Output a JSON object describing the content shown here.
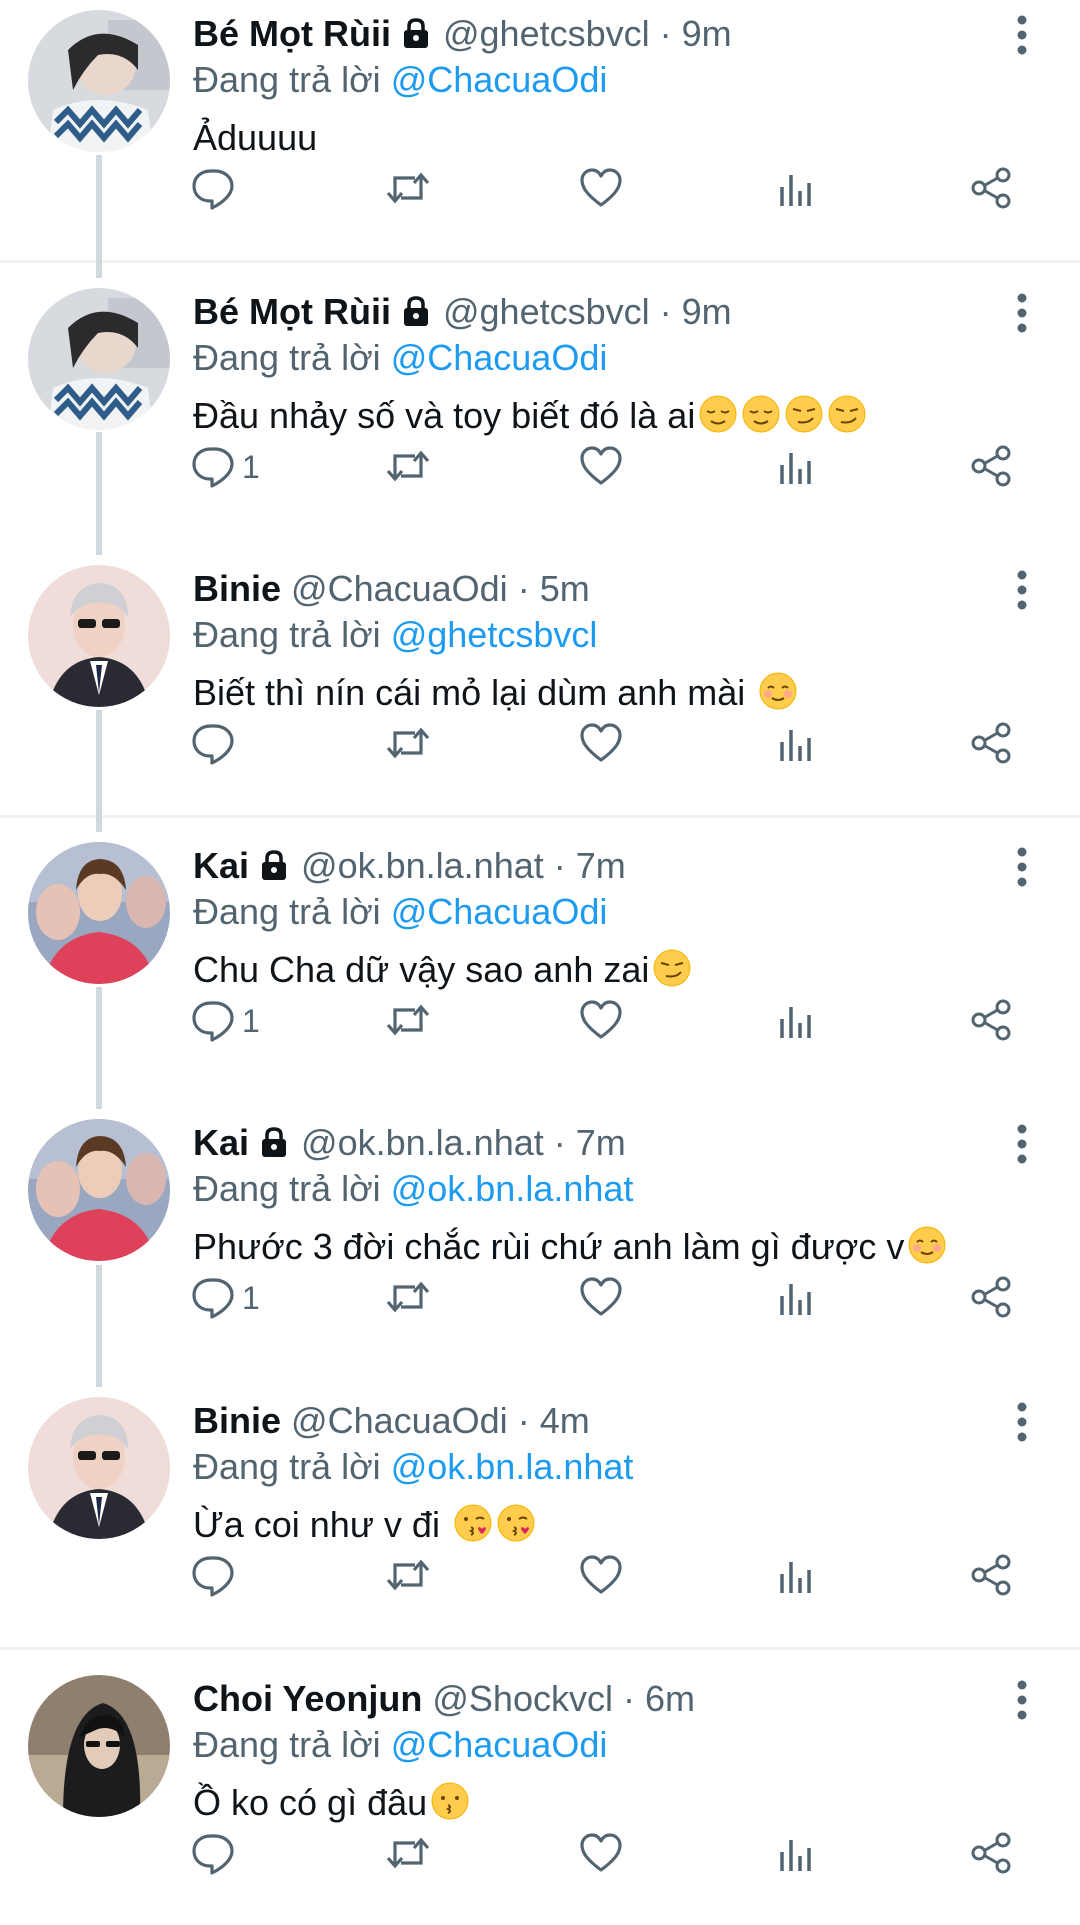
{
  "tweets": [
    {
      "name": "Bé Mọt Rùii",
      "handle": "@ghetcsbvcl",
      "dot": "·",
      "time": "9m",
      "locked": true,
      "reply_prefix": "Đang trả lời",
      "reply_to": "@ChacuaOdi",
      "text": "Ảduuuu",
      "emojis": [],
      "reply_count": "",
      "avatar": "bemot"
    },
    {
      "name": "Bé Mọt Rùii",
      "handle": "@ghetcsbvcl",
      "dot": "·",
      "time": "9m",
      "locked": true,
      "reply_prefix": "Đang trả lời",
      "reply_to": "@ChacuaOdi",
      "text": "Đầu nhảy số và toy biết đó là ai",
      "emojis": [
        "relieved",
        "relieved",
        "smirk",
        "smirk"
      ],
      "reply_count": "1",
      "avatar": "bemot"
    },
    {
      "name": "Binie",
      "handle": "@ChacuaOdi",
      "dot": "·",
      "time": "5m",
      "locked": false,
      "reply_prefix": "Đang trả lời",
      "reply_to": "@ghetcsbvcl",
      "text": "Biết thì nín cái mỏ lại dùm anh mài ",
      "emojis": [
        "blush"
      ],
      "reply_count": "",
      "avatar": "binie"
    },
    {
      "name": "Kai",
      "handle": "@ok.bn.la.nhat",
      "dot": "·",
      "time": "7m",
      "locked": true,
      "reply_prefix": "Đang trả lời",
      "reply_to": "@ChacuaOdi",
      "text": "Chu Cha dữ vậy sao anh zai",
      "emojis": [
        "smirk"
      ],
      "reply_count": "1",
      "avatar": "kai"
    },
    {
      "name": "Kai",
      "handle": "@ok.bn.la.nhat",
      "dot": "·",
      "time": "7m",
      "locked": true,
      "reply_prefix": "Đang trả lời",
      "reply_to": "@ok.bn.la.nhat",
      "text": "Phước 3 đời chắc rùi chứ anh làm gì được v",
      "emojis": [
        "blush"
      ],
      "reply_count": "1",
      "avatar": "kai"
    },
    {
      "name": "Binie",
      "handle": "@ChacuaOdi",
      "dot": "·",
      "time": "4m",
      "locked": false,
      "reply_prefix": "Đang trả lời",
      "reply_to": "@ok.bn.la.nhat",
      "text": "Ừa coi như v đi ",
      "emojis": [
        "kiss",
        "kiss"
      ],
      "reply_count": "",
      "avatar": "binie"
    },
    {
      "name": "Choi Yeonjun",
      "handle": "@Shockvcl",
      "dot": "·",
      "time": "6m",
      "locked": false,
      "reply_prefix": "Đang trả lời",
      "reply_to": "@ChacuaOdi",
      "text": "Ồ ko có gì đâu",
      "emojis": [
        "kissing"
      ],
      "reply_count": "",
      "avatar": "choi"
    }
  ],
  "icons": {
    "reply": "reply-icon",
    "retweet": "retweet-icon",
    "like": "heart-icon",
    "views": "views-icon",
    "share": "share-icon",
    "more": "more-icon",
    "lock": "lock-icon"
  },
  "colors": {
    "link": "#1d9bf0",
    "secondary": "#536471",
    "text": "#0f1419",
    "divider": "#eff3f4",
    "thread_line": "#cfd9de"
  }
}
